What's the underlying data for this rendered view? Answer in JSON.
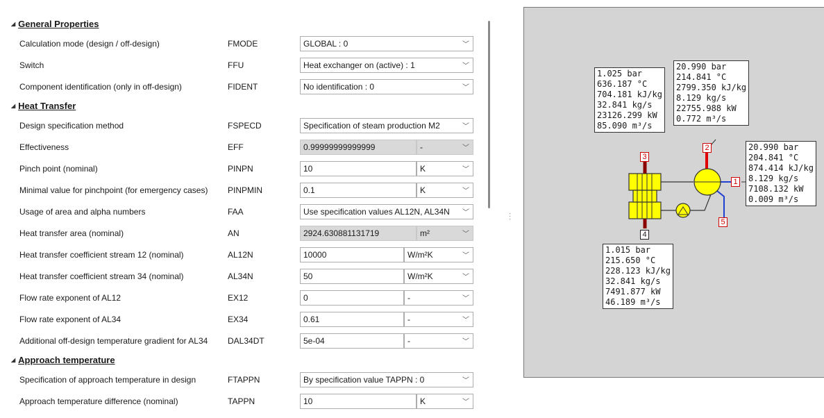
{
  "sections": {
    "general": "General Properties",
    "heat_transfer": "Heat Transfer",
    "approach": "Approach temperature"
  },
  "rows": {
    "fmode": {
      "desc": "Calculation mode (design / off-design)",
      "code": "FMODE",
      "value": "GLOBAL : 0"
    },
    "ffu": {
      "desc": "Switch",
      "code": "FFU",
      "value": "Heat exchanger on (active) : 1"
    },
    "fident": {
      "desc": "Component identification (only in off-design)",
      "code": "FIDENT",
      "value": "No identification : 0"
    },
    "fspecd": {
      "desc": "Design specification method",
      "code": "FSPECD",
      "value": "Specification of steam production M2"
    },
    "eff": {
      "desc": "Effectiveness",
      "code": "EFF",
      "value": "0.99999999999999",
      "unit": "-"
    },
    "pinpn": {
      "desc": "Pinch point (nominal)",
      "code": "PINPN",
      "value": "10",
      "unit": "K"
    },
    "pinpmin": {
      "desc": "Minimal value for pinchpoint (for emergency cases)",
      "code": "PINPMIN",
      "value": "0.1",
      "unit": "K"
    },
    "faa": {
      "desc": "Usage of area and alpha numbers",
      "code": "FAA",
      "value": "Use specification values AL12N, AL34N"
    },
    "an": {
      "desc": "Heat transfer area (nominal)",
      "code": "AN",
      "value": "2924.630881131719",
      "unit": "m²"
    },
    "al12n": {
      "desc": "Heat transfer coefficient stream 12 (nominal)",
      "code": "AL12N",
      "value": "10000",
      "unit": "W/m²K"
    },
    "al34n": {
      "desc": "Heat transfer coefficient stream 34 (nominal)",
      "code": "AL34N",
      "value": "50",
      "unit": "W/m²K"
    },
    "ex12": {
      "desc": "Flow rate exponent of AL12",
      "code": "EX12",
      "value": "0",
      "unit": "-"
    },
    "ex34": {
      "desc": "Flow rate exponent of AL34",
      "code": "EX34",
      "value": "0.61",
      "unit": "-"
    },
    "dal34dt": {
      "desc": "Additional off-design temperature gradient for AL34",
      "code": "DAL34DT",
      "value": "5e-04",
      "unit": "-"
    },
    "ftappn": {
      "desc": "Specification of approach temperature in design",
      "code": "FTAPPN",
      "value": "By specification value TAPPN : 0"
    },
    "tappn": {
      "desc": "Approach temperature difference (nominal)",
      "code": "TAPPN",
      "value": "10",
      "unit": "K"
    }
  },
  "diagram": {
    "box3": [
      "1.025 bar",
      "636.187 °C",
      "704.181 kJ/kg",
      "32.841 kg/s",
      "23126.299 kW",
      "85.090 m³/s"
    ],
    "box2": [
      "20.990 bar",
      "214.841 °C",
      "2799.350 kJ/kg",
      "8.129 kg/s",
      "22755.988 kW",
      "0.772 m³/s"
    ],
    "box1": [
      "20.990 bar",
      "204.841 °C",
      "874.414 kJ/kg",
      "8.129 kg/s",
      "7108.132 kW",
      "0.009 m³/s"
    ],
    "box4": [
      "1.015 bar",
      "215.650 °C",
      "228.123 kJ/kg",
      "32.841 kg/s",
      "7491.877 kW",
      "46.189 m³/s"
    ],
    "ports": {
      "p1": "1",
      "p2": "2",
      "p3": "3",
      "p4": "4",
      "p5": "5"
    }
  },
  "colors": {
    "hot_gas": "#8b0000",
    "steam": "#e00000",
    "water": "#1f3fd0",
    "vessel": "#ffff00"
  }
}
